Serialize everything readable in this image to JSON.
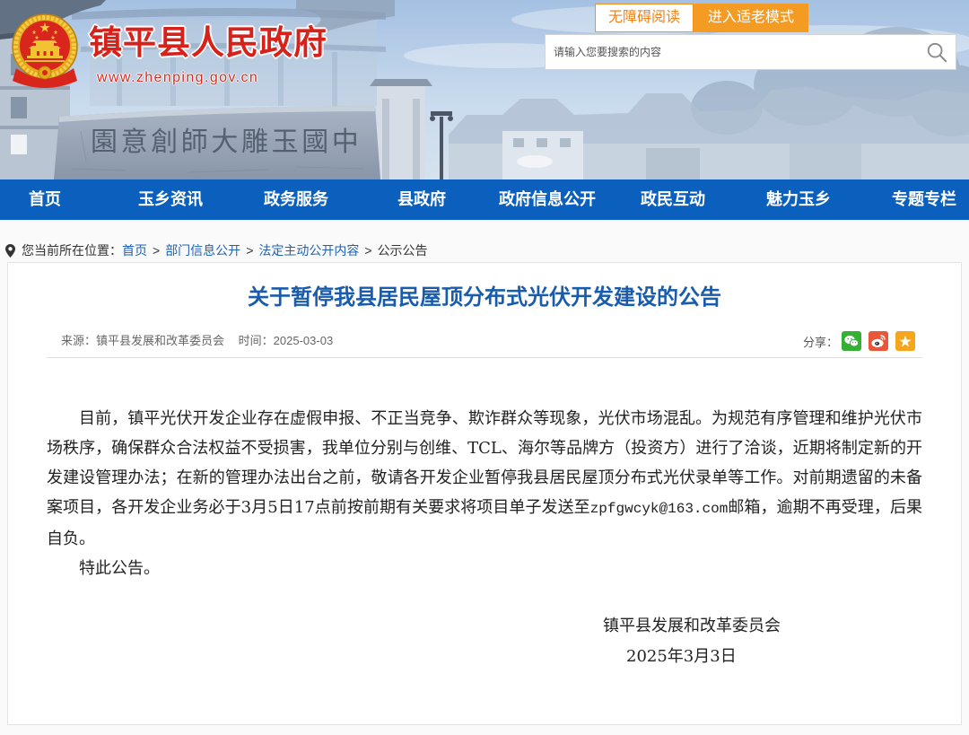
{
  "header": {
    "site_title": "镇平县人民政府",
    "site_url": "www.zhenping.gov.cn",
    "emblem_icon": "national-emblem-icon",
    "banner_monument_text": "園意創師大雕玉國中",
    "accessibility_button": "无障碍阅读",
    "elderly_mode_button": "进入适老模式",
    "search": {
      "placeholder": "请输入您要搜索的内容",
      "value": "",
      "icon": "search-icon"
    }
  },
  "nav": {
    "items": [
      "首页",
      "玉乡资讯",
      "政务服务",
      "县政府",
      "政府信息公开",
      "政民互动",
      "魅力玉乡",
      "专题专栏"
    ]
  },
  "breadcrumb": {
    "icon": "location-pin-icon",
    "label": "您当前所在位置：",
    "separator": ">",
    "items": [
      "首页",
      "部门信息公开",
      "法定主动公开内容",
      "公示公告"
    ]
  },
  "article": {
    "title": "关于暂停我县居民屋顶分布式光伏开发建设的公告",
    "source_label": "来源：",
    "source": "镇平县发展和改革委员会",
    "date_label": "时间：",
    "date": "2025-03-03",
    "share_label": "分享：",
    "share_icons": [
      "wechat-icon",
      "weibo-icon",
      "star-icon"
    ],
    "body": {
      "text_before_email": "目前，镇平光伏开发企业存在虚假申报、不正当竞争、欺诈群众等现象，光伏市场混乱。为规范有序管理和维护光伏市场秩序，确保群众合法权益不受损害，我单位分别与创维、TCL、海尔等品牌方（投资方）进行了洽谈，近期将制定新的开发建设管理办法；在新的管理办法出台之前，敬请各开发企业暂停我县居民屋顶分布式光伏录单等工作。对前期遗留的未备案项目，各开发企业务必于3月5日17点前按前期有关要求将项目单子发送至",
      "email": "zpfgwcyk@163.com",
      "text_after_email": "邮箱，逾期不再受理，后果自负。",
      "closing": "特此公告。"
    },
    "signature": {
      "organization": "镇平县发展和改革委员会",
      "date": "2025年3月3日"
    }
  },
  "colors": {
    "nav_background": "#0b60be",
    "accent_orange": "#f39b22",
    "site_title_red": "#d6221b",
    "link_blue": "#1f62b6",
    "article_title_blue": "#1a5cac",
    "wechat_green": "#34b035",
    "weibo_red": "#e9573b",
    "star_yellow": "#f5a61d"
  }
}
